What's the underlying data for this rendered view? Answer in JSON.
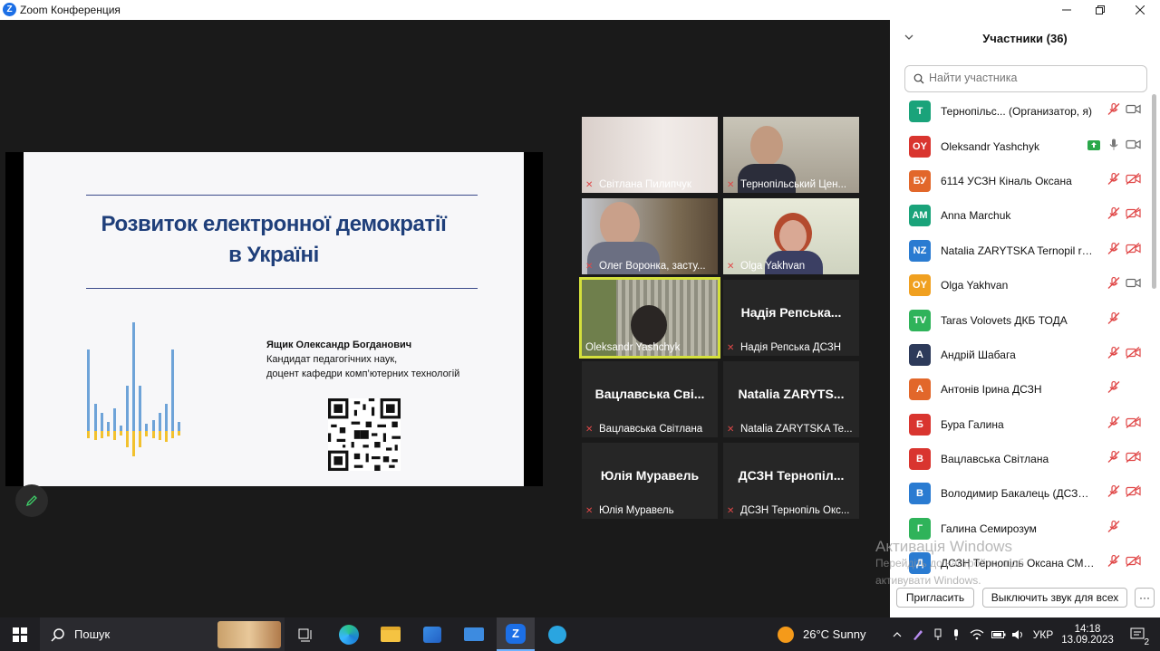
{
  "window": {
    "title": "Zoom Конференция"
  },
  "slide": {
    "title_line1": "Розвиток електронної демократії",
    "title_line2": "в Україні",
    "author_name": "Ящик Олександр Богданович",
    "author_line2": "Кандидат педагогічних наук,",
    "author_line3": "доцент кафедри комп’ютерних технологій",
    "qr_caption": "ɴ"
  },
  "tiles": [
    {
      "label": "Світлана Пилипчук",
      "muted": true
    },
    {
      "label": "Тернопільський Цен...",
      "muted": true
    },
    {
      "label": "Олег Воронка, засту...",
      "muted": true
    },
    {
      "label": "Olga Yakhvan",
      "muted": true
    },
    {
      "label": "Oleksandr Yashchyk",
      "muted": false
    },
    {
      "label": "Надія Репська ДСЗН",
      "big": "Надія  Репська...",
      "muted": true
    },
    {
      "label": "Вацлавська Світлана",
      "big": "Вацлавська  Сві...",
      "muted": true
    },
    {
      "label": "Natalia ZARYTSKA Te...",
      "big": "Natalia  ZARYTS...",
      "muted": true
    },
    {
      "label": "Юлія Муравель",
      "big": "Юлія Муравель",
      "muted": true
    },
    {
      "label": "ДСЗН Тернопіль Окс...",
      "big": "ДСЗН  Тернопіл...",
      "muted": true
    }
  ],
  "panel": {
    "title": "Участники (36)",
    "search_placeholder": "Найти участника",
    "participants": [
      {
        "initials": "T",
        "color": "#1aa37a",
        "name": "Тернопільс...  (Организатор, я)",
        "mic": "muted",
        "video": "on"
      },
      {
        "initials": "OY",
        "color": "#d9352f",
        "name": "Oleksandr Yashchyk",
        "mic": "on",
        "video": "on",
        "share": true
      },
      {
        "initials": "БУ",
        "color": "#e2672a",
        "name": "6114 УСЗН Кіналь Оксана",
        "mic": "muted",
        "video": "off"
      },
      {
        "initials": "AM",
        "color": "#1aa37a",
        "name": "Anna Marchuk",
        "mic": "muted",
        "video": "off"
      },
      {
        "initials": "NZ",
        "color": "#2a7bd1",
        "name": "Natalia ZARYTSKA Ternopil reg...",
        "mic": "muted",
        "video": "off"
      },
      {
        "initials": "OY",
        "color": "#f0a020",
        "name": "Olga Yakhvan",
        "mic": "muted",
        "video": "on"
      },
      {
        "initials": "TV",
        "color": "#2fb35a",
        "name": "Taras Volovets ДКБ ТОДА",
        "mic": "muted",
        "video": "none"
      },
      {
        "initials": "А",
        "color": "#2d3a5a",
        "name": "Андрій Шабага",
        "mic": "muted",
        "video": "off"
      },
      {
        "initials": "А",
        "color": "#e2672a",
        "name": "Антонів Ірина ДСЗН",
        "mic": "muted",
        "video": "none"
      },
      {
        "initials": "Б",
        "color": "#d9352f",
        "name": "Бура Галина",
        "mic": "muted",
        "video": "off"
      },
      {
        "initials": "В",
        "color": "#d9352f",
        "name": "Вацлавська Світлана",
        "mic": "muted",
        "video": "off"
      },
      {
        "initials": "В",
        "color": "#2a7bd1",
        "name": "Володимир Бакалець (ДСЗН Т...",
        "mic": "muted",
        "video": "off"
      },
      {
        "initials": "Г",
        "color": "#2fb35a",
        "name": "Галина Семирозум",
        "mic": "muted",
        "video": "none"
      },
      {
        "initials": "Д",
        "color": "#2a7bd1",
        "name": "ДСЗН Тернопіль Оксана СМО...",
        "mic": "muted",
        "video": "off"
      }
    ],
    "invite_label": "Пригласить",
    "mute_all_label": "Выключить звук для всех",
    "more_label": "···"
  },
  "watermark": {
    "line1": "Активація Windows",
    "line2": "Перейдіть до настройок, щоб",
    "line3": "активувати Windows."
  },
  "taskbar": {
    "search_label": "Пошук",
    "weather": "26°C  Sunny",
    "lang": "УКР",
    "time": "14:18",
    "date": "13.09.2023",
    "notif_count": "2"
  }
}
